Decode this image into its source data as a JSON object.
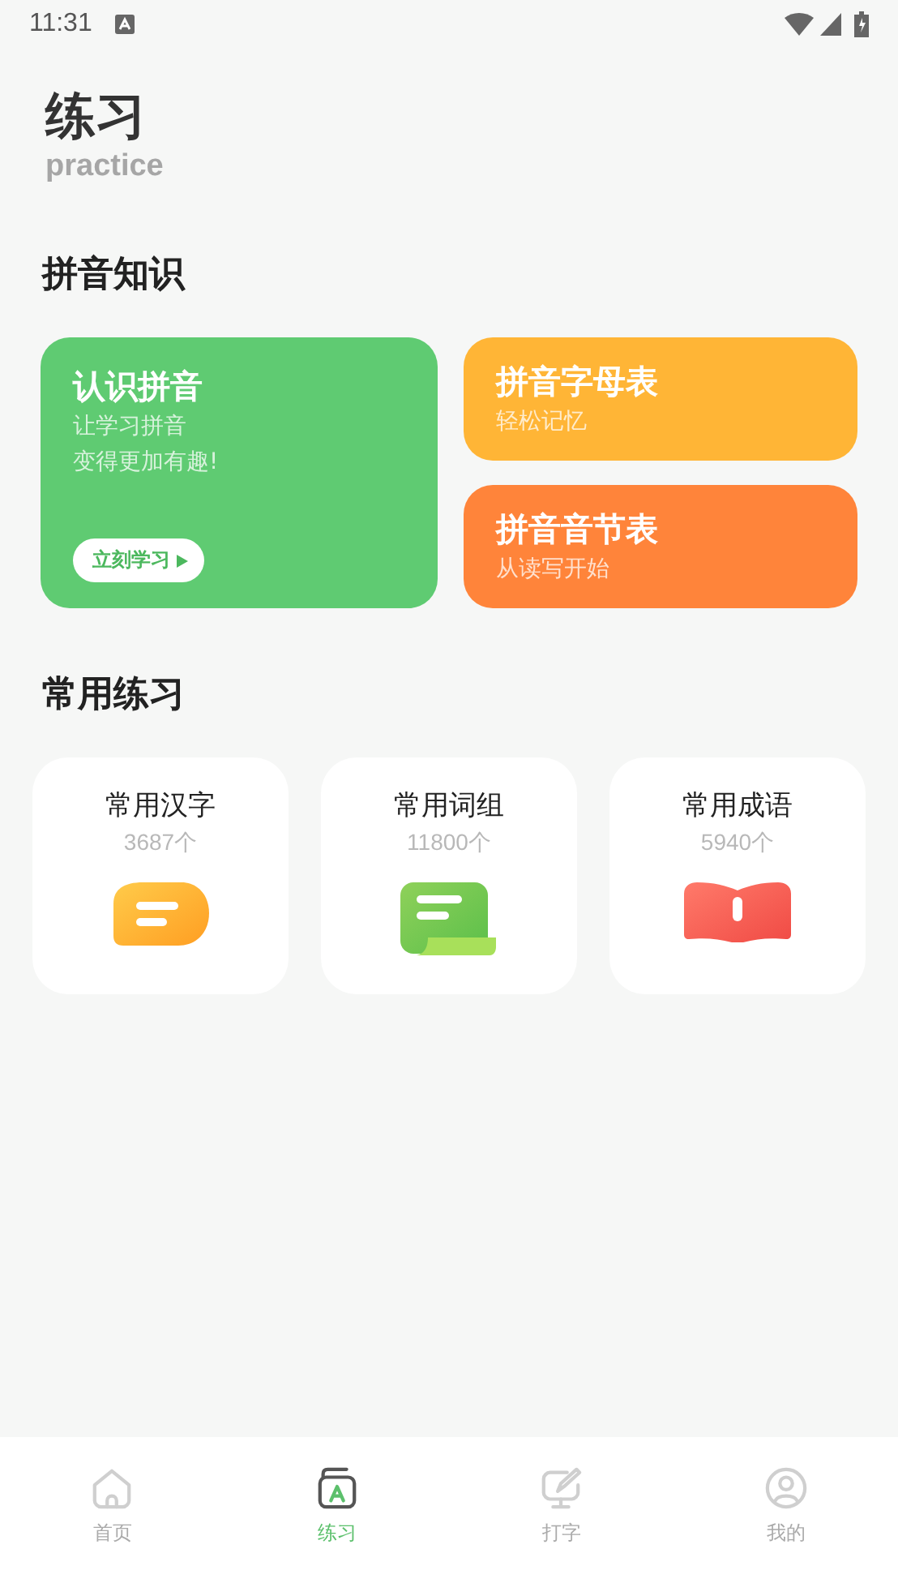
{
  "status_bar": {
    "time": "11:31"
  },
  "header": {
    "title": "练习",
    "subtitle": "practice"
  },
  "pinyin_section": {
    "title": "拼音知识",
    "main_card": {
      "title": "认识拼音",
      "lines": [
        "让学习拼音",
        "变得更加有趣!"
      ],
      "button": "立刻学习"
    },
    "side_cards": [
      {
        "title": "拼音字母表",
        "subtitle": "轻松记忆",
        "color": "#ffb536"
      },
      {
        "title": "拼音音节表",
        "subtitle": "从读写开始",
        "color": "#ff843a"
      }
    ]
  },
  "practice_section": {
    "title": "常用练习",
    "items": [
      {
        "kind": "chat",
        "title": "常用汉字",
        "count": "3687个"
      },
      {
        "kind": "scroll",
        "title": "常用词组",
        "count": "11800个"
      },
      {
        "kind": "book",
        "title": "常用成语",
        "count": "5940个"
      }
    ]
  },
  "bottom_nav": [
    {
      "kind": "home",
      "label": "首页",
      "selected": false
    },
    {
      "kind": "practice",
      "label": "练习",
      "selected": true
    },
    {
      "kind": "typing",
      "label": "打字",
      "selected": false
    },
    {
      "kind": "profile",
      "label": "我的",
      "selected": false
    }
  ]
}
